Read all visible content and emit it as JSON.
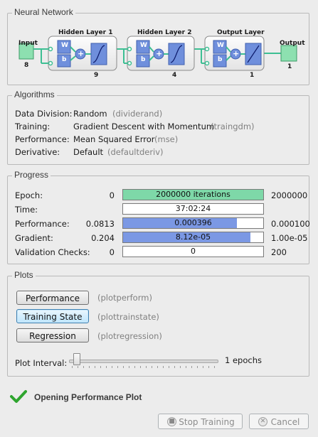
{
  "network": {
    "title": "Neural Network",
    "input": {
      "label": "Input",
      "size": "8"
    },
    "hidden1": {
      "label": "Hidden Layer 1",
      "size": "9"
    },
    "hidden2": {
      "label": "Hidden Layer 2",
      "size": "4"
    },
    "output_layer": {
      "label": "Output Layer",
      "size": "1"
    },
    "output": {
      "label": "Output",
      "size": "1"
    },
    "w": "W",
    "b": "b"
  },
  "algorithms": {
    "title": "Algorithms",
    "rows": [
      {
        "label": "Data Division:",
        "value": "Random",
        "fn": "(dividerand)"
      },
      {
        "label": "Training:",
        "value": "Gradient Descent with Momentum",
        "fn": "(traingdm)"
      },
      {
        "label": "Performance:",
        "value": "Mean Squared Error",
        "fn": "(mse)"
      },
      {
        "label": "Derivative:",
        "value": "Default",
        "fn": "(defaultderiv)"
      }
    ]
  },
  "progress": {
    "title": "Progress",
    "rows": [
      {
        "label": "Epoch:",
        "min": "0",
        "bar_text": "2000000 iterations",
        "max": "2000000",
        "fill_fraction": 1.0,
        "fill_color": "#7ed8a8"
      },
      {
        "label": "Time:",
        "min": "",
        "bar_text": "37:02:24",
        "max": "",
        "fill_fraction": 0,
        "fill_color": "#ffffff"
      },
      {
        "label": "Performance:",
        "min": "0.0813",
        "bar_text": "0.000396",
        "max": "0.000100",
        "fill_fraction": 0.81,
        "fill_color": "#7b98e4"
      },
      {
        "label": "Gradient:",
        "min": "0.204",
        "bar_text": "8.12e-05",
        "max": "1.00e-05",
        "fill_fraction": 0.91,
        "fill_color": "#7b98e4"
      },
      {
        "label": "Validation Checks:",
        "min": "0",
        "bar_text": "0",
        "max": "200",
        "fill_fraction": 0,
        "fill_color": "#ffffff"
      }
    ]
  },
  "plots": {
    "title": "Plots",
    "buttons": [
      {
        "label": "Performance",
        "fn": "(plotperform)"
      },
      {
        "label": "Training State",
        "fn": "(plottrainstate)"
      },
      {
        "label": "Regression",
        "fn": "(plotregression)"
      }
    ],
    "interval_label": "Plot Interval:",
    "interval_value": "1 epochs",
    "slider_fraction": 0
  },
  "status": {
    "text": "Opening Performance Plot"
  },
  "footer": {
    "stop_label": "Stop Training",
    "cancel_label": "Cancel"
  },
  "colors": {
    "input_green": "#8de0b0",
    "layer_blue": "#6f8fdc",
    "check_green": "#2fa52f"
  }
}
